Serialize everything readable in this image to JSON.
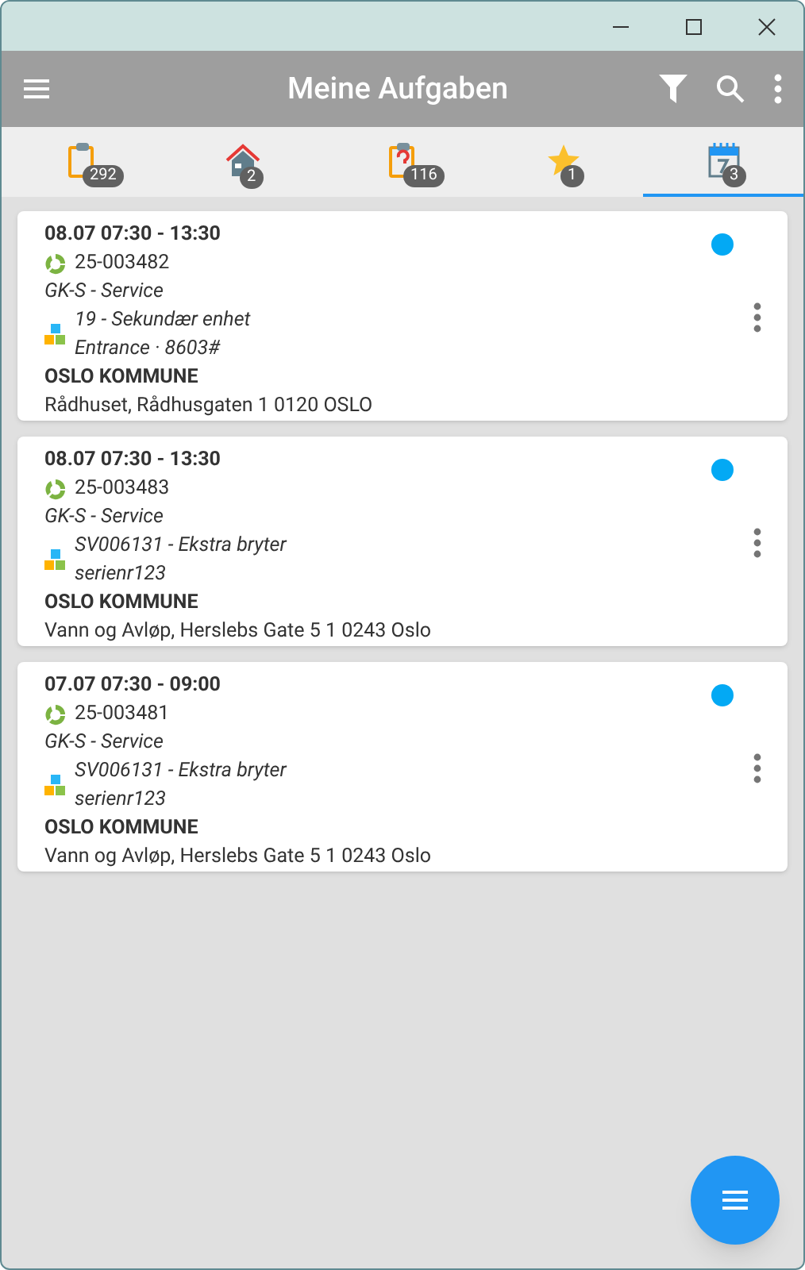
{
  "toolbar": {
    "title": "Meine Aufgaben"
  },
  "tabs": [
    {
      "kind": "clipboard",
      "count": "292",
      "selected": false
    },
    {
      "kind": "house",
      "count": "2",
      "selected": false
    },
    {
      "kind": "clipboard-alert",
      "count": "116",
      "selected": false
    },
    {
      "kind": "star",
      "count": "1",
      "selected": false
    },
    {
      "kind": "calendar",
      "count": "3",
      "selected": true
    }
  ],
  "tasks": [
    {
      "time": "08.07 07:30 - 13:30",
      "number": "25-003482",
      "type": "GK-S - Service",
      "unit": "19 - Sekundær enhet",
      "unit_detail": "Entrance · 8603#",
      "customer": "OSLO KOMMUNE",
      "address": "Rådhuset, Rådhusgaten 1 0120 OSLO",
      "color": "#03a9f4"
    },
    {
      "time": "08.07 07:30 - 13:30",
      "number": "25-003483",
      "type": "GK-S - Service",
      "unit": "SV006131 - Ekstra bryter",
      "unit_detail": "serienr123",
      "customer": "OSLO KOMMUNE",
      "address": "Vann og Avløp, Herslebs Gate 5 1 0243 Oslo",
      "color": "#03a9f4"
    },
    {
      "time": "07.07 07:30 - 09:00",
      "number": "25-003481",
      "type": "GK-S - Service",
      "unit": "SV006131 - Ekstra bryter",
      "unit_detail": "serienr123",
      "customer": "OSLO KOMMUNE",
      "address": "Vann og Avløp, Herslebs Gate 5 1 0243 Oslo",
      "color": "#03a9f4"
    }
  ]
}
